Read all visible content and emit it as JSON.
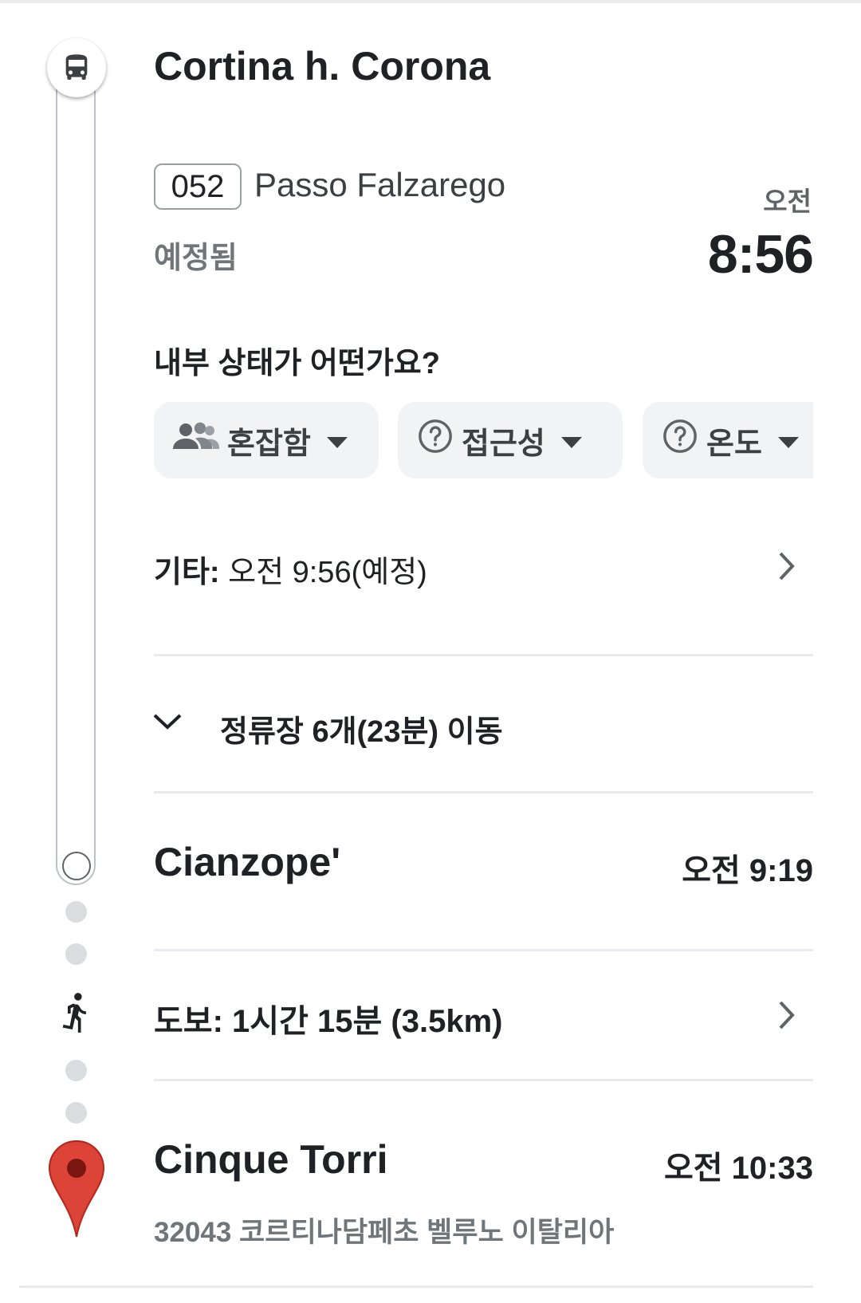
{
  "origin": {
    "stop_name": "Cortina h. Corona",
    "icon": "bus-icon"
  },
  "route": {
    "number": "052",
    "destination": "Passo Falzarego",
    "status": "예정됨",
    "departure_ampm": "오전",
    "departure_time": "8:56"
  },
  "conditions": {
    "question": "내부 상태가 어떤가요?",
    "chips": [
      {
        "label": "혼잡함",
        "icon": "people-icon"
      },
      {
        "label": "접근성",
        "icon": "help-circle-icon"
      },
      {
        "label": "온도",
        "icon": "help-circle-icon"
      }
    ]
  },
  "other": {
    "prefix": "기타:",
    "text": "오전 9:56(예정)"
  },
  "stops": {
    "summary": "정류장 6개(23분) 이동"
  },
  "alight": {
    "stop_name": "Cianzope'",
    "time": "오전 9:19"
  },
  "walk": {
    "text": "도보: 1시간 15분 (3.5km)"
  },
  "destination": {
    "name": "Cinque Torri",
    "time": "오전 10:33",
    "address": "32043 코르티나담페초 벨루노 이탈리아"
  },
  "colors": {
    "pin_red": "#db4437",
    "chip_bg": "#f1f3f4",
    "rail_gray": "#bdc1c6"
  }
}
